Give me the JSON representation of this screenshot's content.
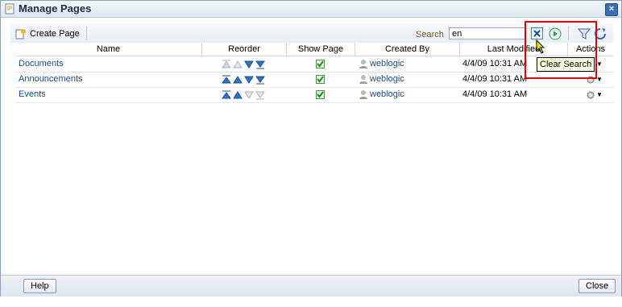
{
  "window": {
    "title": "Manage Pages"
  },
  "toolbar": {
    "create_label": "Create Page",
    "search_label": "Search",
    "search_value": "en"
  },
  "columns": [
    "Name",
    "Reorder",
    "Show Page",
    "Created By",
    "Last Modified",
    "Actions"
  ],
  "rows": [
    {
      "name": "Documents",
      "created_by": "weblogic",
      "modified": "4/4/09 10:31 AM",
      "show": true
    },
    {
      "name": "Announcements",
      "created_by": "weblogic",
      "modified": "4/4/09 10:31 AM",
      "show": true
    },
    {
      "name": "Events",
      "created_by": "weblogic",
      "modified": "4/4/09 10:31 AM",
      "show": true
    }
  ],
  "tooltip": "Clear Search",
  "footer": {
    "help_label": "Help",
    "close_label": "Close"
  },
  "colors": {
    "highlight_box": "#e00000",
    "link": "#1e4c8a"
  }
}
